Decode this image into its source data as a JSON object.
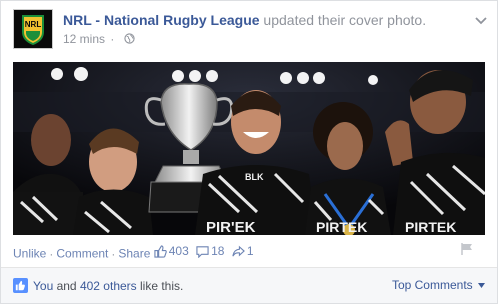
{
  "post": {
    "page_name": "NRL - National Rugby League",
    "action_text": " updated their cover photo.",
    "timestamp": "12 mins",
    "privacy_icon": "globe-icon",
    "logo_text": "NRL"
  },
  "actions": {
    "unlike": "Unlike",
    "comment": "Comment",
    "share": "Share",
    "like_count": "403",
    "comment_count": "18",
    "share_count": "1"
  },
  "footer": {
    "likes_you": "You",
    "likes_and": " and ",
    "likes_others": "402 others",
    "likes_tail": " like this.",
    "sort_label": "Top Comments"
  },
  "photo": {
    "jersey_text": "PIR'EK",
    "jersey_text_2": "PIRTEK",
    "sleeve_text": "BLK"
  },
  "colors": {
    "link": "#3b5998",
    "muted": "#90949c",
    "kiwi_blue": "#2a6fd6",
    "trophy": "#c9c9c9"
  }
}
